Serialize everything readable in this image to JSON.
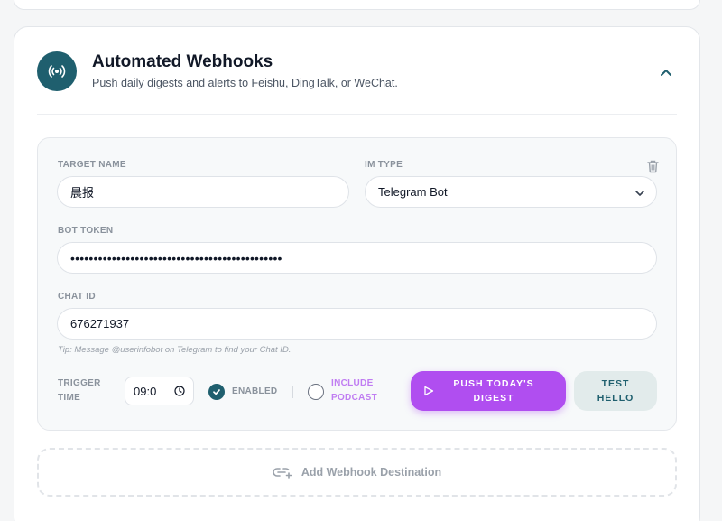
{
  "section": {
    "title": "Automated Webhooks",
    "subtitle": "Push daily digests and alerts to Feishu, DingTalk, or WeChat."
  },
  "webhook": {
    "target_name_label": "TARGET NAME",
    "target_name_value": "晨报",
    "im_type_label": "IM TYPE",
    "im_type_value": "Telegram Bot",
    "bot_token_label": "BOT TOKEN",
    "bot_token_value": "••••••••••••••••••••••••••••••••••••••••••••••",
    "chat_id_label": "CHAT ID",
    "chat_id_value": "676271937",
    "tip": "Tip: Message @userinfobot on Telegram to find your Chat ID.",
    "trigger_time_label_line1": "TRIGGER",
    "trigger_time_label_line2": "TIME",
    "trigger_time_value": "09:0",
    "enabled_label": "ENABLED",
    "enabled": true,
    "include_podcast_line1": "INCLUDE",
    "include_podcast_line2": "PODCAST",
    "include_podcast": false,
    "push_btn_line1": "PUSH TODAY'S",
    "push_btn_line2": "DIGEST",
    "test_btn_line1": "TEST",
    "test_btn_line2": "HELLO"
  },
  "add_destination_label": "Add Webhook Destination",
  "icons": {
    "header": "broadcast-icon",
    "collapse": "chevron-up-icon",
    "delete": "trash-icon",
    "dropdown": "chevron-down-icon",
    "clock": "clock-icon",
    "push": "send-icon",
    "add": "link-add-icon"
  },
  "colors": {
    "accent_teal": "#1f5f6e",
    "accent_purple": "#b04ef0",
    "podcast_label": "#c07df2"
  }
}
